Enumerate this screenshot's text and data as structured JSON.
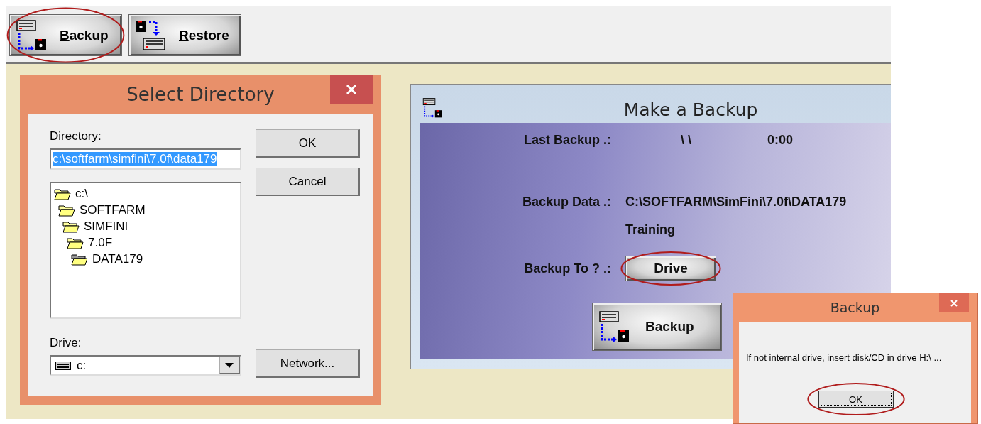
{
  "toolbar": {
    "buttons": [
      {
        "label": "Backup",
        "circled": true
      },
      {
        "label": "Restore",
        "circled": false
      }
    ]
  },
  "select_directory": {
    "title": "Select Directory",
    "directory_label": "Directory:",
    "directory_value": "c:\\softfarm\\simfini\\7.0f\\data179",
    "buttons": [
      "OK",
      "Cancel"
    ],
    "folders": [
      {
        "name": "c:\\",
        "selected": false,
        "children": [
          {
            "name": "SOFTFARM",
            "selected": false,
            "children": [
              {
                "name": "SIMFINI",
                "selected": false,
                "children": [
                  {
                    "name": "7.0F",
                    "selected": false,
                    "children": [
                      {
                        "name": "DATA179",
                        "selected": true
                      }
                    ]
                  }
                ]
              }
            ]
          }
        ]
      }
    ],
    "drive_label": "Drive:",
    "drive_value": "c:",
    "network_button": "Network..."
  },
  "make_backup": {
    "title": "Make a Backup",
    "last_backup": {
      "label": "Last Backup .:",
      "date": "\\ \\",
      "time": "0:00"
    },
    "backup_data": {
      "label": "Backup Data .:",
      "path": "C:\\SOFTFARM\\SimFini\\7.0f\\DATA179",
      "name": "Training"
    },
    "backup_to": {
      "label": "Backup To ? .:",
      "button": "Drive",
      "circled": true
    },
    "backup_button": {
      "label": "Backup"
    }
  },
  "message_box": {
    "title": "Backup",
    "message": "If not internal drive, insert disk/CD in drive H:\\ ...",
    "button": "OK",
    "circled": true
  }
}
